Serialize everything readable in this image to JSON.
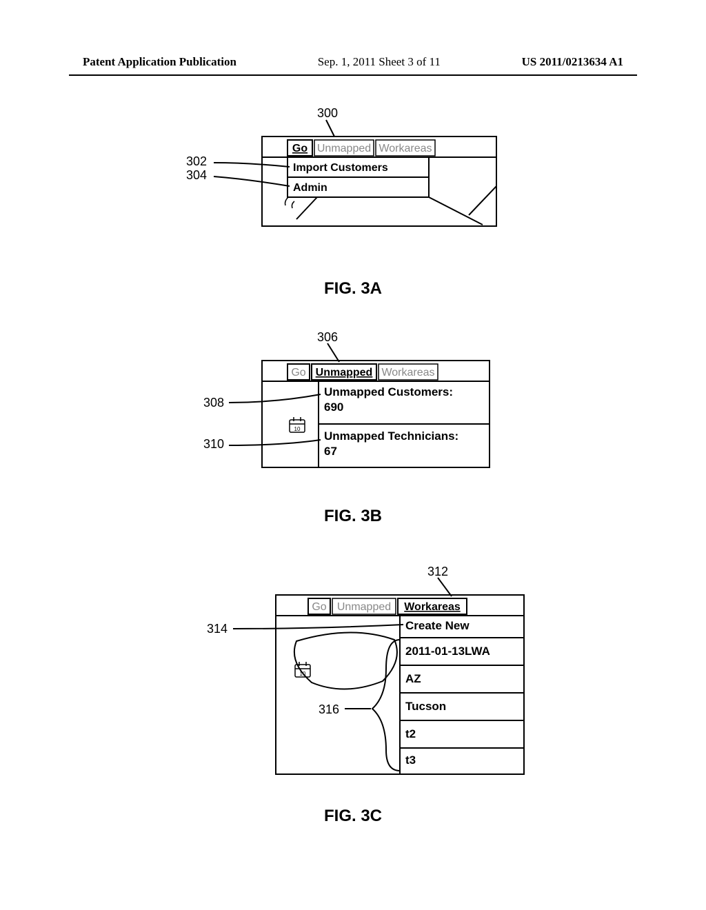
{
  "header": {
    "left": "Patent Application Publication",
    "center": "Sep. 1, 2011  Sheet 3 of 11",
    "right": "US 2011/0213634 A1"
  },
  "figA": {
    "caption": "FIG. 3A",
    "callouts": {
      "topLead": "300",
      "c1": "302",
      "c2": "304"
    },
    "tabs": {
      "go": "Go",
      "unmapped": "Unmapped",
      "workareas": "Workareas"
    },
    "menu": {
      "item1": "Import Customers",
      "item2": "Admin"
    }
  },
  "figB": {
    "caption": "FIG. 3B",
    "callouts": {
      "topLead": "306",
      "c1": "308",
      "c2": "310"
    },
    "tabs": {
      "go": "Go",
      "unmapped": "Unmapped",
      "workareas": "Workareas"
    },
    "text": {
      "line1": "Unmapped Customers:",
      "line1val": "690",
      "line2": "Unmapped Technicians:",
      "line2val": "67"
    }
  },
  "figC": {
    "caption": "FIG. 3C",
    "callouts": {
      "topLead": "312",
      "c1": "314",
      "brace": "316"
    },
    "tabs": {
      "go": "Go",
      "unmapped": "Unmapped",
      "workareas": "Workareas"
    },
    "menu": {
      "createNew": "Create New",
      "items": [
        "2011-01-13LWA",
        "AZ",
        "Tucson",
        "t2",
        "t3"
      ]
    }
  }
}
